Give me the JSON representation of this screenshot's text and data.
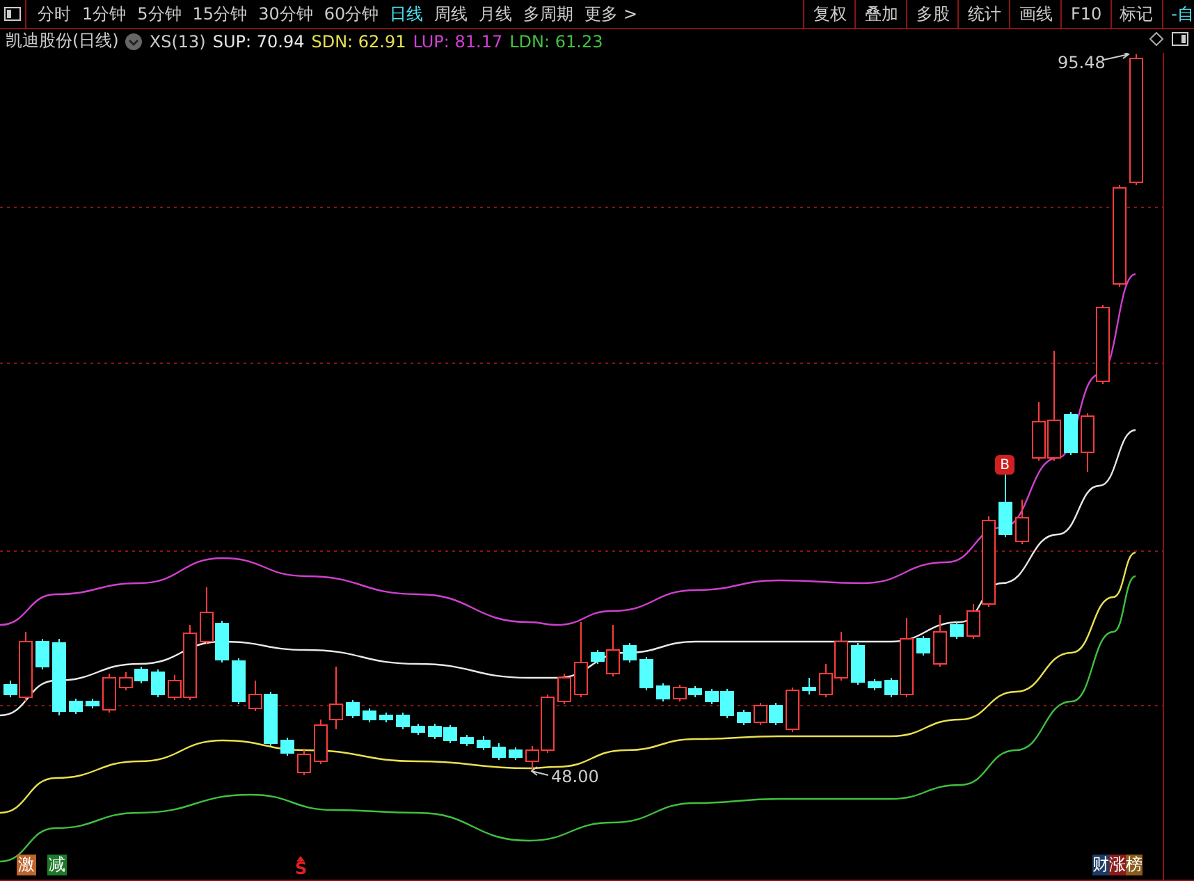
{
  "toolbar": {
    "periods": [
      {
        "label": "分时",
        "selected": false
      },
      {
        "label": "1分钟",
        "selected": false
      },
      {
        "label": "5分钟",
        "selected": false
      },
      {
        "label": "15分钟",
        "selected": false
      },
      {
        "label": "30分钟",
        "selected": false
      },
      {
        "label": "60分钟",
        "selected": false
      },
      {
        "label": "日线",
        "selected": true
      },
      {
        "label": "周线",
        "selected": false
      },
      {
        "label": "月线",
        "selected": false
      },
      {
        "label": "多周期",
        "selected": false
      },
      {
        "label": "更多 >",
        "selected": false
      }
    ],
    "tools": [
      "复权",
      "叠加",
      "多股",
      "统计",
      "画线",
      "F10",
      "标记",
      "-自"
    ]
  },
  "legend": {
    "title": "凯迪股份(日线)",
    "indicator": "XS(13)",
    "values": [
      {
        "label": "SUP: 70.94",
        "color": "#e8e8e8"
      },
      {
        "label": "SDN: 62.91",
        "color": "#e8e050"
      },
      {
        "label": "LUP: 81.17",
        "color": "#d040d0"
      },
      {
        "label": "LDN: 61.23",
        "color": "#40c040"
      }
    ]
  },
  "chart": {
    "high_label": "95.48",
    "low_label": "48.00",
    "signal": "B",
    "sell_marker": "S"
  },
  "badges": [
    {
      "label": "激",
      "color": "#c0642c"
    },
    {
      "label": "减",
      "color": "#1e7a2a"
    }
  ],
  "ranking": [
    {
      "label": "财",
      "color": "#1c3c64"
    },
    {
      "label": "涨",
      "color": "#8c1c1c"
    },
    {
      "label": "榜",
      "color": "#8c5c1c"
    }
  ]
}
